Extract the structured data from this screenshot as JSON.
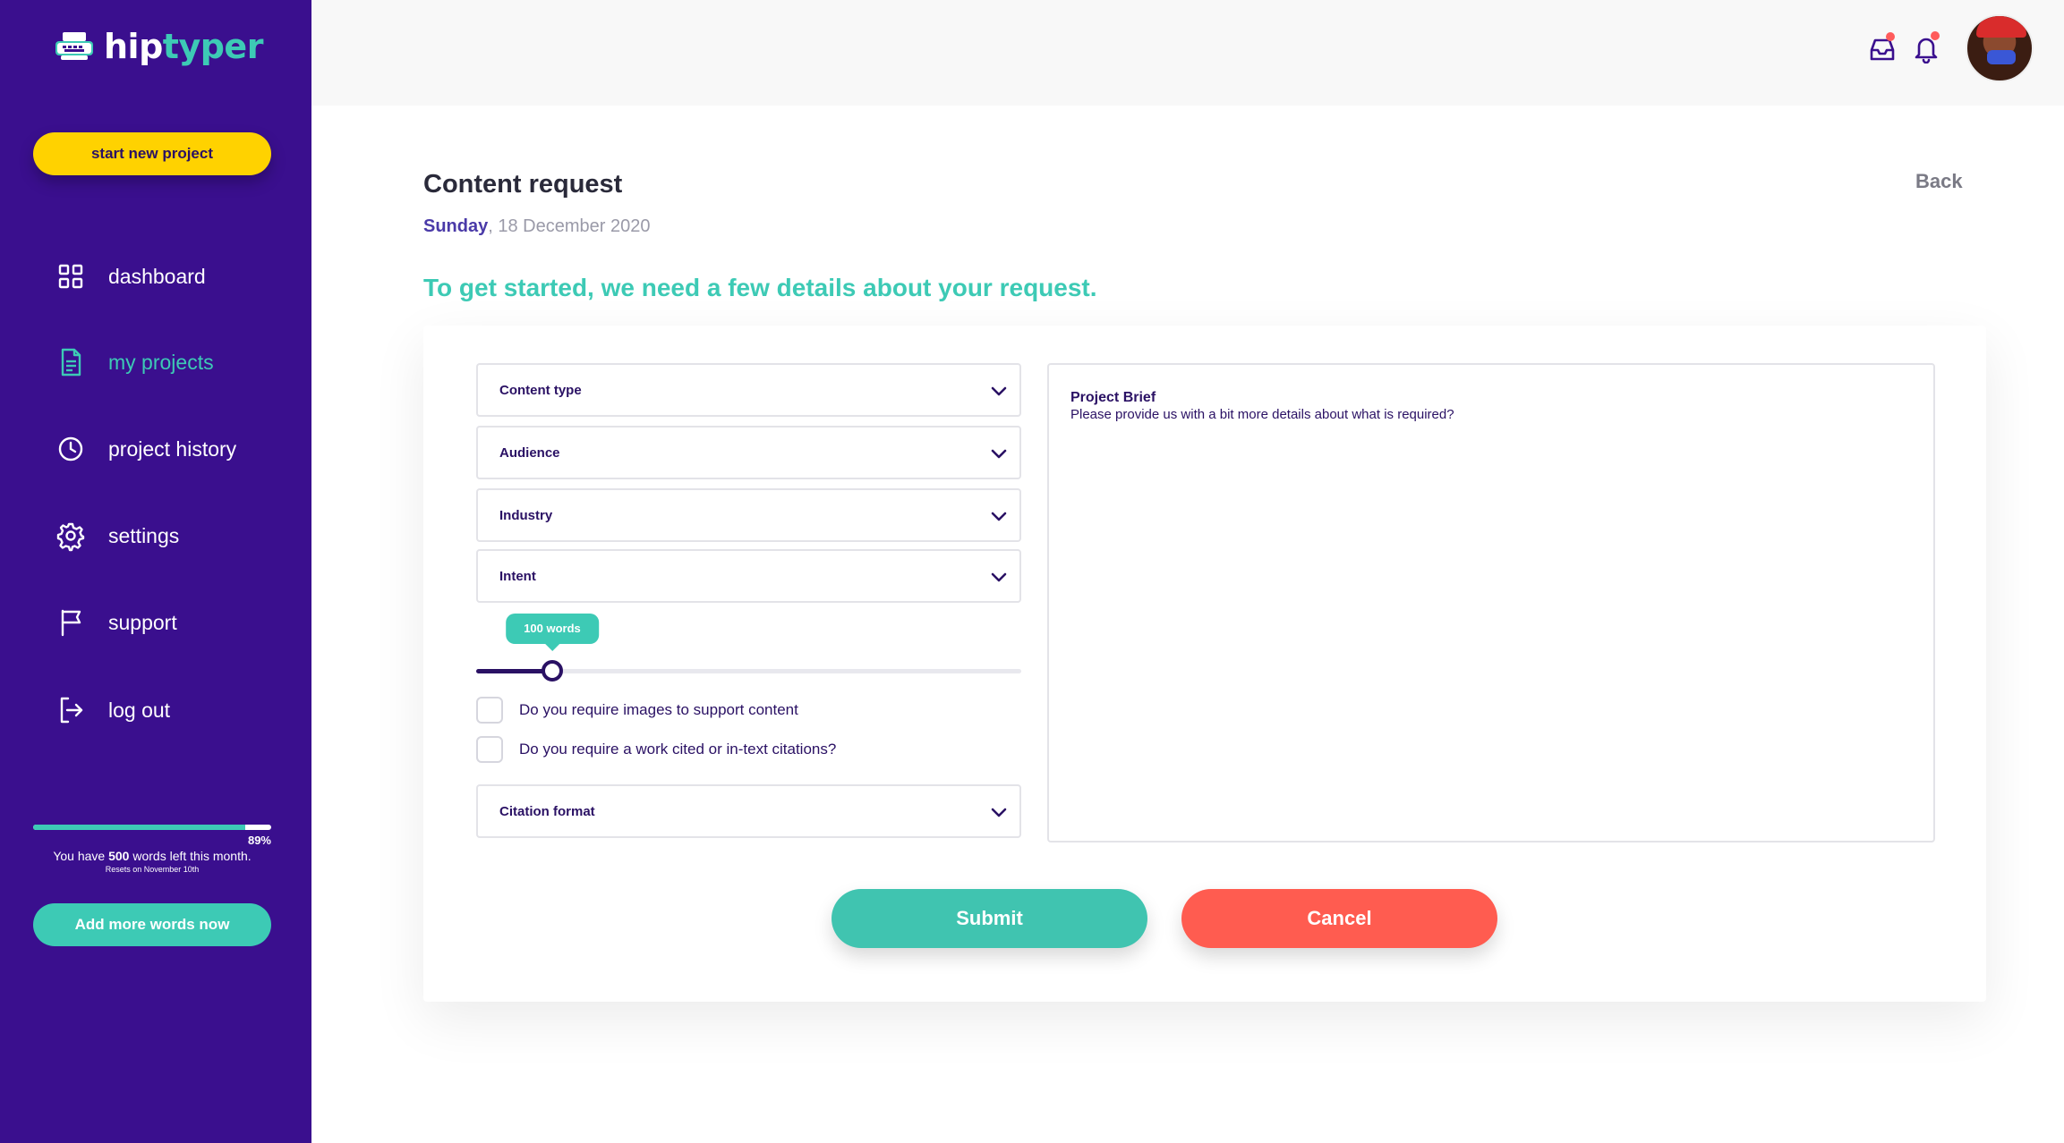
{
  "brand": {
    "logo_part1": "hip",
    "logo_part2": "typer",
    "colors": {
      "sidebar": "#3a0f8e",
      "accent": "#3dcab5",
      "cta_yellow": "#ffd200",
      "cancel_red": "#ff5c50",
      "text_dark": "#2a1164"
    }
  },
  "sidebar": {
    "start_button": "start new project",
    "items": [
      {
        "label": "dashboard",
        "icon": "grid-icon",
        "active": false
      },
      {
        "label": "my projects",
        "icon": "document-icon",
        "active": true
      },
      {
        "label": "project history",
        "icon": "clock-icon",
        "active": false
      },
      {
        "label": "settings",
        "icon": "gear-icon",
        "active": false
      },
      {
        "label": "support",
        "icon": "flag-icon",
        "active": false
      },
      {
        "label": "log out",
        "icon": "logout-icon",
        "active": false
      }
    ],
    "usage": {
      "percent": 89,
      "percent_label": "89%",
      "words_prefix": "You have ",
      "words_count": "500",
      "words_suffix": " words left this month.",
      "resets": "Resets on November 10th"
    },
    "add_words_button": "Add more words now"
  },
  "header": {
    "icons": [
      "inbox-icon",
      "bell-icon"
    ],
    "avatar": "user-avatar"
  },
  "main": {
    "title": "Content request",
    "date_day": "Sunday",
    "date_rest": ", 18 December 2020",
    "back_label": "Back",
    "intro": "To get started, we need a few details about your request.",
    "selects": {
      "content_type": "Content type",
      "audience": "Audience",
      "industry": "Industry",
      "intent": "Intent",
      "citation_format": "Citation format"
    },
    "word_slider": {
      "label": "100 words",
      "fraction": 0.14
    },
    "checkboxes": {
      "images": "Do you require images to support content",
      "citations": "Do you require a work cited or in-text citations?"
    },
    "brief": {
      "title": "Project Brief",
      "text": "Please provide us with a bit more details about what is required?"
    },
    "submit_label": "Submit",
    "cancel_label": "Cancel"
  }
}
